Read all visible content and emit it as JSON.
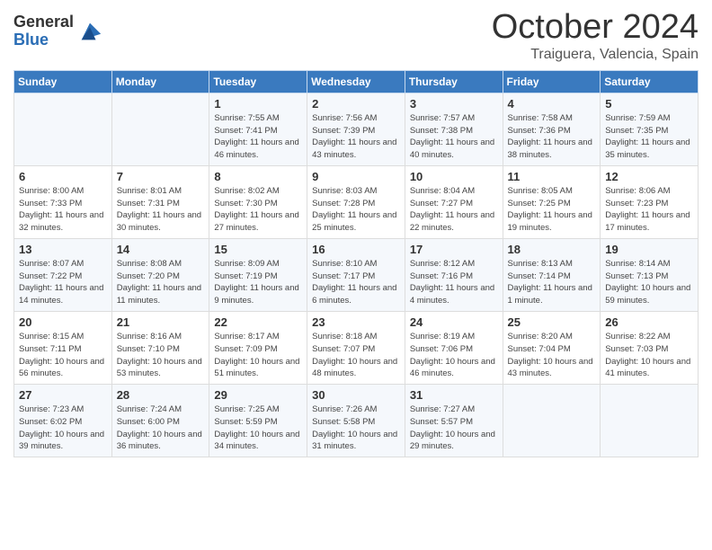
{
  "header": {
    "logo_general": "General",
    "logo_blue": "Blue",
    "month_title": "October 2024",
    "subtitle": "Traiguera, Valencia, Spain"
  },
  "days_of_week": [
    "Sunday",
    "Monday",
    "Tuesday",
    "Wednesday",
    "Thursday",
    "Friday",
    "Saturday"
  ],
  "weeks": [
    [
      {
        "day": "",
        "info": ""
      },
      {
        "day": "",
        "info": ""
      },
      {
        "day": "1",
        "info": "Sunrise: 7:55 AM\nSunset: 7:41 PM\nDaylight: 11 hours and 46 minutes."
      },
      {
        "day": "2",
        "info": "Sunrise: 7:56 AM\nSunset: 7:39 PM\nDaylight: 11 hours and 43 minutes."
      },
      {
        "day": "3",
        "info": "Sunrise: 7:57 AM\nSunset: 7:38 PM\nDaylight: 11 hours and 40 minutes."
      },
      {
        "day": "4",
        "info": "Sunrise: 7:58 AM\nSunset: 7:36 PM\nDaylight: 11 hours and 38 minutes."
      },
      {
        "day": "5",
        "info": "Sunrise: 7:59 AM\nSunset: 7:35 PM\nDaylight: 11 hours and 35 minutes."
      }
    ],
    [
      {
        "day": "6",
        "info": "Sunrise: 8:00 AM\nSunset: 7:33 PM\nDaylight: 11 hours and 32 minutes."
      },
      {
        "day": "7",
        "info": "Sunrise: 8:01 AM\nSunset: 7:31 PM\nDaylight: 11 hours and 30 minutes."
      },
      {
        "day": "8",
        "info": "Sunrise: 8:02 AM\nSunset: 7:30 PM\nDaylight: 11 hours and 27 minutes."
      },
      {
        "day": "9",
        "info": "Sunrise: 8:03 AM\nSunset: 7:28 PM\nDaylight: 11 hours and 25 minutes."
      },
      {
        "day": "10",
        "info": "Sunrise: 8:04 AM\nSunset: 7:27 PM\nDaylight: 11 hours and 22 minutes."
      },
      {
        "day": "11",
        "info": "Sunrise: 8:05 AM\nSunset: 7:25 PM\nDaylight: 11 hours and 19 minutes."
      },
      {
        "day": "12",
        "info": "Sunrise: 8:06 AM\nSunset: 7:23 PM\nDaylight: 11 hours and 17 minutes."
      }
    ],
    [
      {
        "day": "13",
        "info": "Sunrise: 8:07 AM\nSunset: 7:22 PM\nDaylight: 11 hours and 14 minutes."
      },
      {
        "day": "14",
        "info": "Sunrise: 8:08 AM\nSunset: 7:20 PM\nDaylight: 11 hours and 11 minutes."
      },
      {
        "day": "15",
        "info": "Sunrise: 8:09 AM\nSunset: 7:19 PM\nDaylight: 11 hours and 9 minutes."
      },
      {
        "day": "16",
        "info": "Sunrise: 8:10 AM\nSunset: 7:17 PM\nDaylight: 11 hours and 6 minutes."
      },
      {
        "day": "17",
        "info": "Sunrise: 8:12 AM\nSunset: 7:16 PM\nDaylight: 11 hours and 4 minutes."
      },
      {
        "day": "18",
        "info": "Sunrise: 8:13 AM\nSunset: 7:14 PM\nDaylight: 11 hours and 1 minute."
      },
      {
        "day": "19",
        "info": "Sunrise: 8:14 AM\nSunset: 7:13 PM\nDaylight: 10 hours and 59 minutes."
      }
    ],
    [
      {
        "day": "20",
        "info": "Sunrise: 8:15 AM\nSunset: 7:11 PM\nDaylight: 10 hours and 56 minutes."
      },
      {
        "day": "21",
        "info": "Sunrise: 8:16 AM\nSunset: 7:10 PM\nDaylight: 10 hours and 53 minutes."
      },
      {
        "day": "22",
        "info": "Sunrise: 8:17 AM\nSunset: 7:09 PM\nDaylight: 10 hours and 51 minutes."
      },
      {
        "day": "23",
        "info": "Sunrise: 8:18 AM\nSunset: 7:07 PM\nDaylight: 10 hours and 48 minutes."
      },
      {
        "day": "24",
        "info": "Sunrise: 8:19 AM\nSunset: 7:06 PM\nDaylight: 10 hours and 46 minutes."
      },
      {
        "day": "25",
        "info": "Sunrise: 8:20 AM\nSunset: 7:04 PM\nDaylight: 10 hours and 43 minutes."
      },
      {
        "day": "26",
        "info": "Sunrise: 8:22 AM\nSunset: 7:03 PM\nDaylight: 10 hours and 41 minutes."
      }
    ],
    [
      {
        "day": "27",
        "info": "Sunrise: 7:23 AM\nSunset: 6:02 PM\nDaylight: 10 hours and 39 minutes."
      },
      {
        "day": "28",
        "info": "Sunrise: 7:24 AM\nSunset: 6:00 PM\nDaylight: 10 hours and 36 minutes."
      },
      {
        "day": "29",
        "info": "Sunrise: 7:25 AM\nSunset: 5:59 PM\nDaylight: 10 hours and 34 minutes."
      },
      {
        "day": "30",
        "info": "Sunrise: 7:26 AM\nSunset: 5:58 PM\nDaylight: 10 hours and 31 minutes."
      },
      {
        "day": "31",
        "info": "Sunrise: 7:27 AM\nSunset: 5:57 PM\nDaylight: 10 hours and 29 minutes."
      },
      {
        "day": "",
        "info": ""
      },
      {
        "day": "",
        "info": ""
      }
    ]
  ]
}
